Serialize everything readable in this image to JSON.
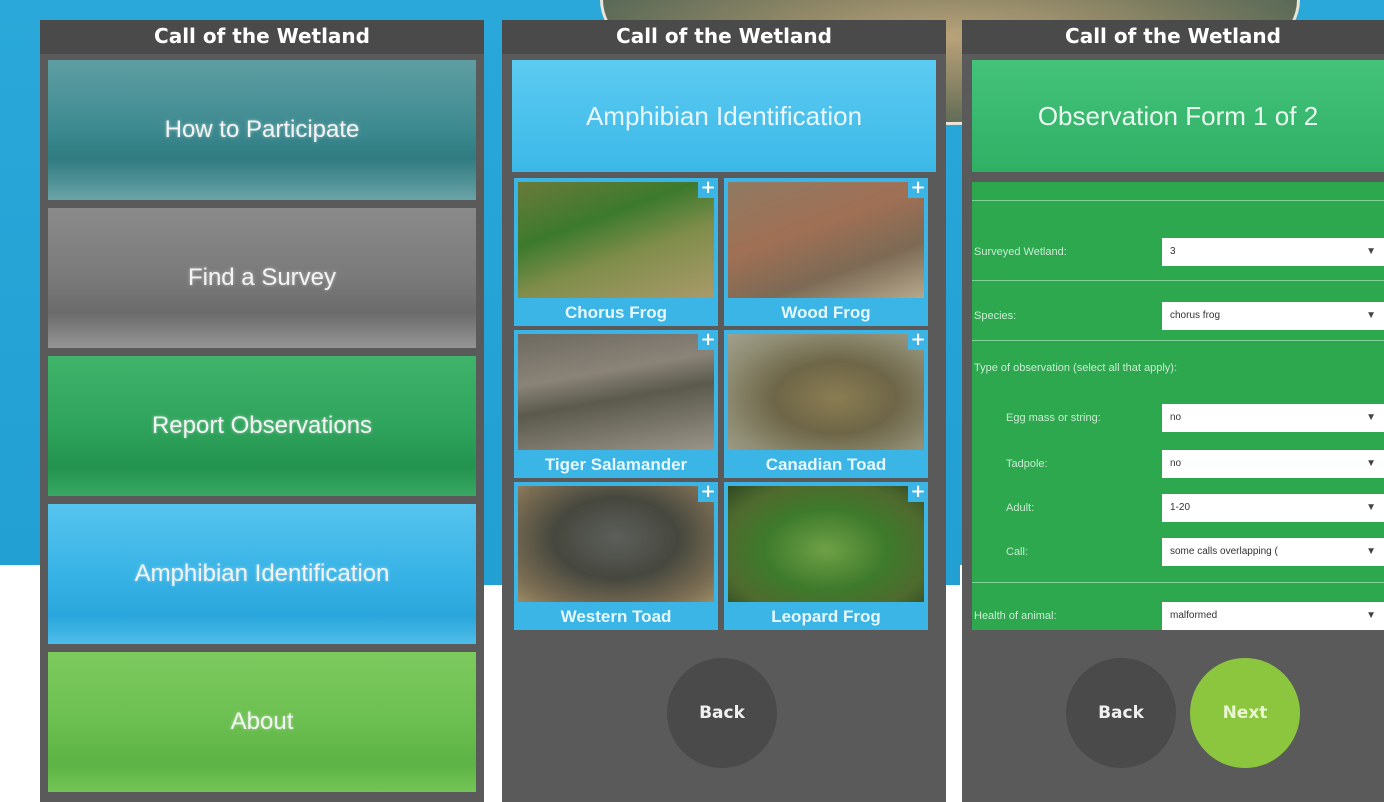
{
  "app_title": "Call of the Wetland",
  "screen1": {
    "menu": [
      {
        "label": "How to Participate"
      },
      {
        "label": "Find a Survey"
      },
      {
        "label": "Report Observations"
      },
      {
        "label": "Amphibian Identification"
      },
      {
        "label": "About"
      }
    ]
  },
  "screen2": {
    "header": "Amphibian Identification",
    "species": [
      {
        "name": "Chorus Frog"
      },
      {
        "name": "Wood Frog"
      },
      {
        "name": "Tiger Salamander"
      },
      {
        "name": "Canadian Toad"
      },
      {
        "name": "Western Toad"
      },
      {
        "name": "Leopard Frog"
      }
    ],
    "plus_symbol": "+",
    "back_label": "Back"
  },
  "screen3": {
    "header": "Observation Form 1 of 2",
    "fields": {
      "wetland": {
        "label": "Surveyed Wetland:",
        "value": "3"
      },
      "species": {
        "label": "Species:",
        "value": "chorus frog"
      },
      "type_heading": "Type of observation (select all that apply):",
      "egg": {
        "label": "Egg mass or string:",
        "value": "no"
      },
      "tadpole": {
        "label": "Tadpole:",
        "value": "no"
      },
      "adult": {
        "label": "Adult:",
        "value": "1-20"
      },
      "call": {
        "label": "Call:",
        "value": "some calls overlapping ("
      },
      "health": {
        "label": "Health of animal:",
        "value": "malformed"
      }
    },
    "caret": "▼",
    "back_label": "Back",
    "next_label": "Next"
  },
  "colors": {
    "sky_blue": "#229fd3",
    "panel_grey": "#5a5a5a",
    "lime_button": "#8cc63f",
    "form_green": "#2da84f"
  }
}
